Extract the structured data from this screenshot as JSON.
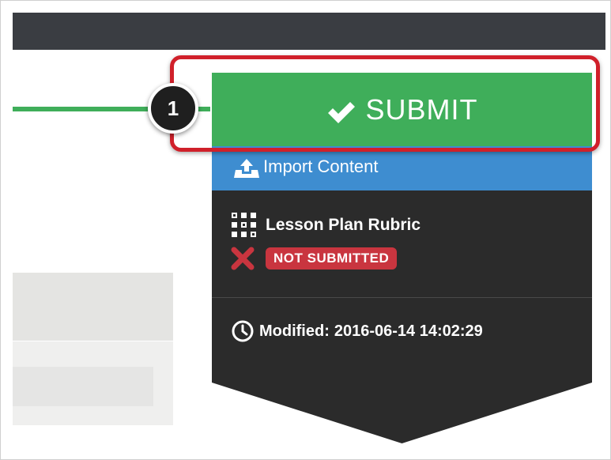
{
  "header": {
    "bar_color": "#3a3d42"
  },
  "submit": {
    "label": "SUBMIT",
    "icon": "check-icon",
    "color": "#3fae5a"
  },
  "step_marker": {
    "number": "1",
    "highlight_color": "#d0202a"
  },
  "import": {
    "label": "Import Content",
    "icon": "upload-tray-icon",
    "color": "#3e8dd0"
  },
  "rubric": {
    "title": "Lesson Plan Rubric",
    "icon": "grid-icon"
  },
  "status": {
    "label": "NOT SUBMITTED",
    "icon": "x-icon",
    "color": "#c9353f"
  },
  "modified": {
    "label": "Modified:",
    "timestamp": "2016-06-14 14:02:29",
    "icon": "clock-icon"
  }
}
